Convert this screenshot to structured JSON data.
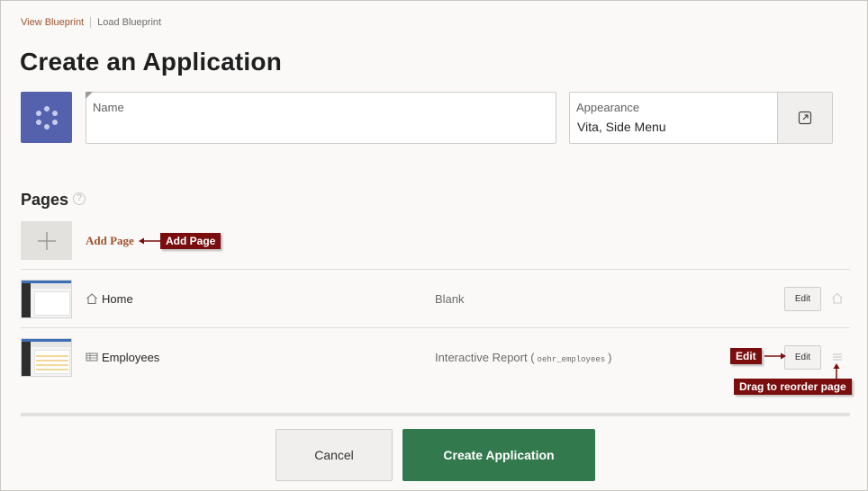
{
  "breadcrumb": {
    "view_blueprint": "View Blueprint",
    "load_blueprint": "Load Blueprint"
  },
  "page_title": "Create an Application",
  "name_field": {
    "label": "Name",
    "value": ""
  },
  "appearance": {
    "label": "Appearance",
    "value": "Vita, Side Menu"
  },
  "pages_section": {
    "title": "Pages",
    "help": "?",
    "add_page": "Add Page",
    "rows": [
      {
        "name": "Home",
        "type": "Blank",
        "edit": "Edit"
      },
      {
        "name": "Employees",
        "type_prefix": "Interactive Report (",
        "table": "oehr_employees",
        "type_suffix": ")",
        "edit": "Edit"
      }
    ]
  },
  "callouts": {
    "add_page": "Add Page",
    "edit": "Edit",
    "drag": "Drag to reorder page"
  },
  "footer": {
    "cancel": "Cancel",
    "create": "Create Application"
  },
  "colors": {
    "accent_link": "#a0522d",
    "primary_button": "#327a4d",
    "app_icon": "#5461ad",
    "callout": "#7a0d0d"
  }
}
